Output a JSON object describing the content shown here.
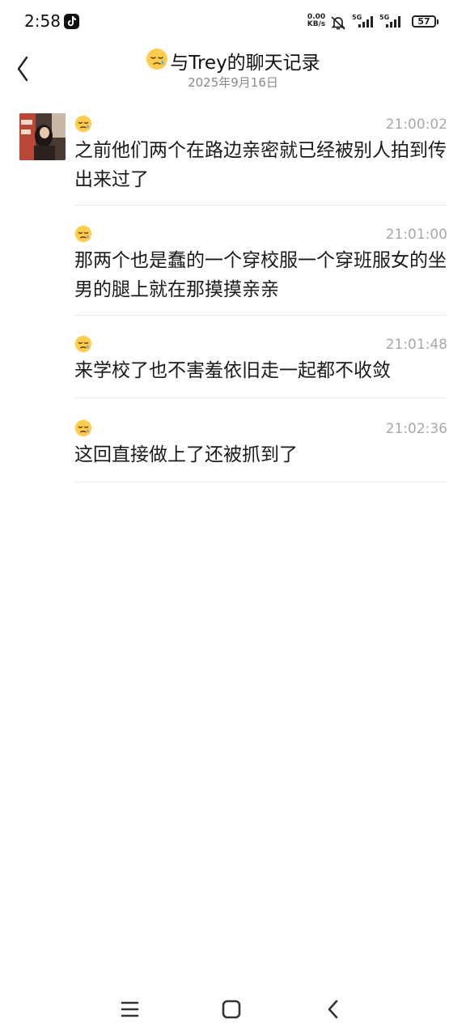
{
  "status_bar": {
    "time": "2:58",
    "net_speed_value": "0.00",
    "net_speed_unit": "KB/s",
    "signal1_label": "5G",
    "signal2_label": "5G",
    "battery": "57"
  },
  "header": {
    "title": "与Trey的聊天记录",
    "subtitle": "2025年9月16日",
    "title_emoji": "sleepy-face"
  },
  "messages": [
    {
      "emoji": "sleepy-face",
      "time": "21:00:02",
      "text": "之前他们两个在路边亲密就已经被别人拍到传出来过了"
    },
    {
      "emoji": "sleepy-face",
      "time": "21:01:00",
      "text": "那两个也是蠢的一个穿校服一个穿班服女的坐男的腿上就在那摸摸亲亲"
    },
    {
      "emoji": "sleepy-face",
      "time": "21:01:48",
      "text": "来学校了也不害羞依旧走一起都不收敛"
    },
    {
      "emoji": "sleepy-face",
      "time": "21:02:36",
      "text": "这回直接做上了还被抓到了"
    }
  ],
  "nav_bar": {
    "menu_icon": "menu-icon",
    "home_icon": "home-icon",
    "back_icon": "back-icon"
  }
}
